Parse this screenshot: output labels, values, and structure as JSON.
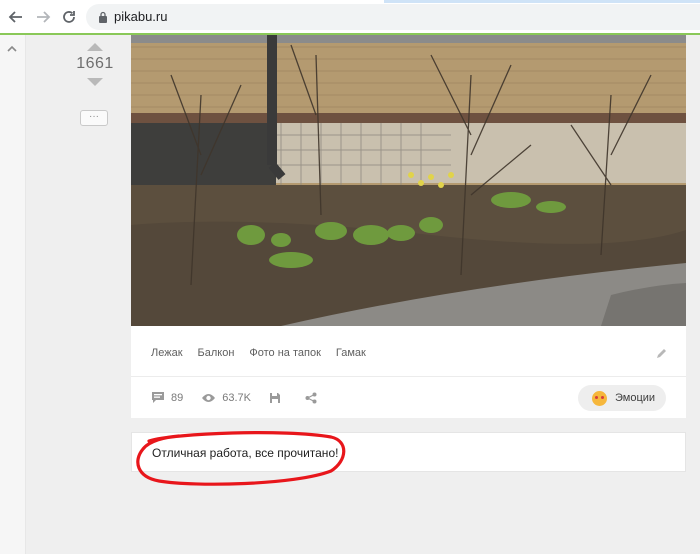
{
  "browser": {
    "url": "pikabu.ru"
  },
  "post": {
    "rating": "1661",
    "more_label": "···",
    "tags": [
      "Лежак",
      "Балкон",
      "Фото на тапок",
      "Гамак"
    ],
    "comments_count": "89",
    "views_count": "63.7K",
    "emotions_label": "Эмоции"
  },
  "comment_box": {
    "text": "Отличная работа, все прочитано!"
  },
  "colors": {
    "annotation": "#e8161b",
    "accent_green": "#8ac858"
  }
}
